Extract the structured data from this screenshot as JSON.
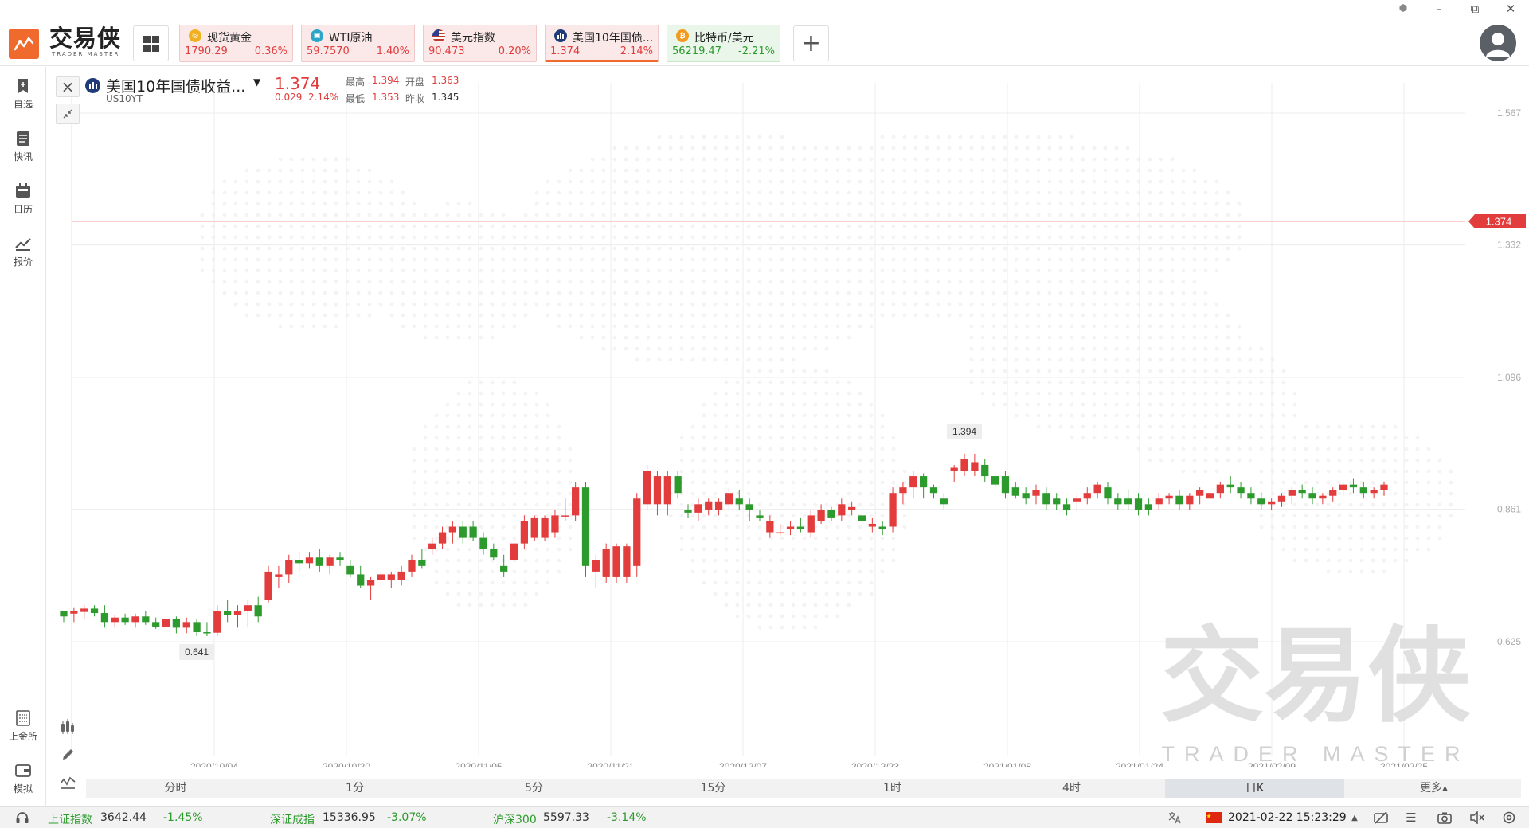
{
  "app": {
    "logo_text": "交易侠",
    "logo_sub": "TRADER MASTER"
  },
  "tickers": [
    {
      "name": "现货黄金",
      "price": "1790.29",
      "change": "0.36%",
      "trend": "up",
      "icon": "gold-icon",
      "icon_color": "#f0b020"
    },
    {
      "name": "WTI原油",
      "price": "59.7570",
      "change": "1.40%",
      "trend": "up",
      "icon": "oil-icon",
      "icon_color": "#2aa7c8"
    },
    {
      "name": "美元指数",
      "price": "90.473",
      "change": "0.20%",
      "trend": "up",
      "icon": "us-flag-icon",
      "icon_color": "#c0392b"
    },
    {
      "name": "美国10年国债...",
      "price": "1.374",
      "change": "2.14%",
      "trend": "up",
      "icon": "bond-icon",
      "icon_color": "#1f3c78",
      "active": true
    },
    {
      "name": "比特币/美元",
      "price": "56219.47",
      "change": "-2.21%",
      "trend": "down",
      "icon": "bitcoin-icon",
      "icon_color": "#f39a1e"
    }
  ],
  "sidebar": {
    "items": [
      {
        "label": "自选",
        "icon": "bookmark-icon"
      },
      {
        "label": "快讯",
        "icon": "news-icon"
      },
      {
        "label": "日历",
        "icon": "calendar-icon"
      },
      {
        "label": "报价",
        "icon": "chart-line-icon"
      }
    ],
    "bottom_items": [
      {
        "label": "上金所",
        "icon": "exchange-icon"
      },
      {
        "label": "模拟",
        "icon": "wallet-icon"
      }
    ]
  },
  "symbol": {
    "name": "美国10年国债收益...",
    "code": "US10YT",
    "price": "1.374",
    "change": "0.029",
    "change_pct": "2.14%",
    "high_label": "最高",
    "high": "1.394",
    "open_label": "开盘",
    "open": "1.363",
    "low_label": "最低",
    "low": "1.353",
    "prev_label": "昨收",
    "prev": "1.345"
  },
  "periods": [
    "分时",
    "1分",
    "5分",
    "15分",
    "1时",
    "4时",
    "日K",
    "更多▴"
  ],
  "active_period": "日K",
  "status": {
    "indices": [
      {
        "name": "上证指数",
        "value": "3642.44",
        "change": "-1.45%"
      },
      {
        "name": "深证成指",
        "value": "15336.95",
        "change": "-3.07%"
      },
      {
        "name": "沪深300",
        "value": "5597.33",
        "change": "-3.14%"
      }
    ],
    "datetime": "2021-02-22 15:23:29"
  },
  "chart_data": {
    "type": "candlestick",
    "x_tick_labels": [
      "2020/10/04",
      "2020/10/20",
      "2020/11/05",
      "2020/11/21",
      "2020/12/07",
      "2020/12/23",
      "2021/01/08",
      "2021/01/24",
      "2021/02/09",
      "2021/02/25"
    ],
    "y_tick_labels": [
      "1.567",
      "1.332",
      "1.096",
      "0.861",
      "0.625"
    ],
    "ylim": [
      0.55,
      1.6
    ],
    "current_price_label": "1.374",
    "current_price": 1.374,
    "max_label": "1.394",
    "min_label": "0.641",
    "watermark": "交易侠",
    "watermark_sub": "TRADER MASTER",
    "up_color": "#e23c3c",
    "down_color": "#2d9a2d",
    "candles": [
      [
        0.68,
        0.68,
        0.66,
        0.67
      ],
      [
        0.675,
        0.685,
        0.66,
        0.68
      ],
      [
        0.678,
        0.69,
        0.665,
        0.684
      ],
      [
        0.684,
        0.69,
        0.67,
        0.676
      ],
      [
        0.676,
        0.69,
        0.65,
        0.66
      ],
      [
        0.66,
        0.672,
        0.65,
        0.668
      ],
      [
        0.668,
        0.675,
        0.655,
        0.66
      ],
      [
        0.66,
        0.675,
        0.65,
        0.67
      ],
      [
        0.67,
        0.68,
        0.655,
        0.66
      ],
      [
        0.66,
        0.668,
        0.648,
        0.652
      ],
      [
        0.652,
        0.67,
        0.645,
        0.665
      ],
      [
        0.665,
        0.67,
        0.64,
        0.65
      ],
      [
        0.65,
        0.668,
        0.64,
        0.66
      ],
      [
        0.66,
        0.665,
        0.635,
        0.642
      ],
      [
        0.642,
        0.66,
        0.635,
        0.641
      ],
      [
        0.641,
        0.69,
        0.635,
        0.68
      ],
      [
        0.68,
        0.7,
        0.66,
        0.672
      ],
      [
        0.672,
        0.69,
        0.65,
        0.68
      ],
      [
        0.68,
        0.7,
        0.65,
        0.69
      ],
      [
        0.69,
        0.705,
        0.66,
        0.67
      ],
      [
        0.7,
        0.76,
        0.695,
        0.75
      ],
      [
        0.74,
        0.76,
        0.72,
        0.745
      ],
      [
        0.745,
        0.78,
        0.73,
        0.77
      ],
      [
        0.77,
        0.785,
        0.75,
        0.765
      ],
      [
        0.765,
        0.785,
        0.755,
        0.775
      ],
      [
        0.775,
        0.79,
        0.75,
        0.76
      ],
      [
        0.76,
        0.78,
        0.745,
        0.775
      ],
      [
        0.775,
        0.785,
        0.76,
        0.77
      ],
      [
        0.76,
        0.77,
        0.74,
        0.745
      ],
      [
        0.745,
        0.76,
        0.72,
        0.725
      ],
      [
        0.725,
        0.74,
        0.7,
        0.735
      ],
      [
        0.735,
        0.75,
        0.725,
        0.745
      ],
      [
        0.735,
        0.75,
        0.72,
        0.745
      ],
      [
        0.735,
        0.76,
        0.725,
        0.75
      ],
      [
        0.75,
        0.78,
        0.74,
        0.77
      ],
      [
        0.77,
        0.79,
        0.755,
        0.76
      ],
      [
        0.79,
        0.81,
        0.78,
        0.8
      ],
      [
        0.8,
        0.83,
        0.79,
        0.82
      ],
      [
        0.82,
        0.84,
        0.8,
        0.83
      ],
      [
        0.83,
        0.84,
        0.8,
        0.81
      ],
      [
        0.83,
        0.84,
        0.805,
        0.81
      ],
      [
        0.81,
        0.82,
        0.78,
        0.79
      ],
      [
        0.79,
        0.8,
        0.77,
        0.775
      ],
      [
        0.76,
        0.78,
        0.74,
        0.75
      ],
      [
        0.77,
        0.81,
        0.765,
        0.8
      ],
      [
        0.8,
        0.85,
        0.79,
        0.84
      ],
      [
        0.81,
        0.85,
        0.805,
        0.845
      ],
      [
        0.81,
        0.85,
        0.805,
        0.845
      ],
      [
        0.82,
        0.86,
        0.81,
        0.85
      ],
      [
        0.85,
        0.88,
        0.84,
        0.85
      ],
      [
        0.85,
        0.91,
        0.84,
        0.9
      ],
      [
        0.9,
        0.91,
        0.74,
        0.76
      ],
      [
        0.75,
        0.78,
        0.72,
        0.77
      ],
      [
        0.74,
        0.8,
        0.73,
        0.79
      ],
      [
        0.74,
        0.8,
        0.73,
        0.795
      ],
      [
        0.74,
        0.8,
        0.73,
        0.795
      ],
      [
        0.76,
        0.89,
        0.74,
        0.88
      ],
      [
        0.87,
        0.94,
        0.86,
        0.93
      ],
      [
        0.87,
        0.93,
        0.85,
        0.92
      ],
      [
        0.87,
        0.93,
        0.85,
        0.92
      ],
      [
        0.92,
        0.93,
        0.88,
        0.89
      ],
      [
        0.86,
        0.87,
        0.845,
        0.855
      ],
      [
        0.855,
        0.88,
        0.84,
        0.87
      ],
      [
        0.86,
        0.88,
        0.85,
        0.875
      ],
      [
        0.86,
        0.88,
        0.85,
        0.875
      ],
      [
        0.87,
        0.9,
        0.86,
        0.89
      ],
      [
        0.88,
        0.895,
        0.86,
        0.87
      ],
      [
        0.87,
        0.88,
        0.84,
        0.86
      ],
      [
        0.85,
        0.86,
        0.84,
        0.845
      ],
      [
        0.82,
        0.85,
        0.81,
        0.84
      ],
      [
        0.82,
        0.835,
        0.815,
        0.82
      ],
      [
        0.825,
        0.84,
        0.815,
        0.83
      ],
      [
        0.83,
        0.845,
        0.82,
        0.825
      ],
      [
        0.82,
        0.86,
        0.81,
        0.85
      ],
      [
        0.84,
        0.87,
        0.835,
        0.86
      ],
      [
        0.86,
        0.865,
        0.84,
        0.845
      ],
      [
        0.85,
        0.88,
        0.84,
        0.87
      ],
      [
        0.86,
        0.875,
        0.85,
        0.865
      ],
      [
        0.85,
        0.86,
        0.83,
        0.84
      ],
      [
        0.83,
        0.845,
        0.82,
        0.835
      ],
      [
        0.83,
        0.84,
        0.815,
        0.825
      ],
      [
        0.83,
        0.9,
        0.82,
        0.89
      ],
      [
        0.89,
        0.91,
        0.87,
        0.9
      ],
      [
        0.9,
        0.93,
        0.88,
        0.92
      ],
      [
        0.92,
        0.925,
        0.88,
        0.9
      ],
      [
        0.9,
        0.905,
        0.88,
        0.89
      ],
      [
        0.88,
        0.89,
        0.86,
        0.87
      ],
      [
        0.93,
        0.94,
        0.91,
        0.935
      ],
      [
        0.93,
        0.96,
        0.92,
        0.95
      ],
      [
        0.93,
        0.96,
        0.92,
        0.945
      ],
      [
        0.94,
        0.95,
        0.91,
        0.92
      ],
      [
        0.92,
        0.925,
        0.9,
        0.905
      ],
      [
        0.92,
        0.93,
        0.88,
        0.89
      ],
      [
        0.9,
        0.91,
        0.88,
        0.885
      ],
      [
        0.89,
        0.9,
        0.87,
        0.88
      ],
      [
        0.885,
        0.905,
        0.87,
        0.895
      ],
      [
        0.89,
        0.9,
        0.86,
        0.87
      ],
      [
        0.88,
        0.89,
        0.86,
        0.87
      ],
      [
        0.87,
        0.88,
        0.85,
        0.86
      ],
      [
        0.875,
        0.89,
        0.86,
        0.88
      ],
      [
        0.88,
        0.9,
        0.87,
        0.89
      ],
      [
        0.89,
        0.91,
        0.88,
        0.905
      ],
      [
        0.9,
        0.91,
        0.87,
        0.88
      ],
      [
        0.88,
        0.89,
        0.86,
        0.87
      ],
      [
        0.88,
        0.895,
        0.86,
        0.87
      ],
      [
        0.88,
        0.89,
        0.85,
        0.86
      ],
      [
        0.87,
        0.88,
        0.85,
        0.86
      ],
      [
        0.87,
        0.89,
        0.86,
        0.88
      ],
      [
        0.88,
        0.89,
        0.87,
        0.885
      ],
      [
        0.885,
        0.895,
        0.86,
        0.87
      ],
      [
        0.87,
        0.89,
        0.86,
        0.885
      ],
      [
        0.885,
        0.9,
        0.87,
        0.895
      ],
      [
        0.88,
        0.9,
        0.87,
        0.89
      ],
      [
        0.89,
        0.91,
        0.88,
        0.905
      ],
      [
        0.905,
        0.92,
        0.89,
        0.9
      ],
      [
        0.9,
        0.91,
        0.88,
        0.89
      ],
      [
        0.89,
        0.9,
        0.87,
        0.88
      ],
      [
        0.88,
        0.89,
        0.86,
        0.87
      ],
      [
        0.87,
        0.88,
        0.86,
        0.875
      ],
      [
        0.875,
        0.89,
        0.865,
        0.885
      ],
      [
        0.885,
        0.9,
        0.87,
        0.895
      ],
      [
        0.895,
        0.905,
        0.88,
        0.89
      ],
      [
        0.89,
        0.9,
        0.87,
        0.88
      ],
      [
        0.88,
        0.89,
        0.87,
        0.885
      ],
      [
        0.885,
        0.9,
        0.875,
        0.895
      ],
      [
        0.895,
        0.91,
        0.885,
        0.905
      ],
      [
        0.905,
        0.915,
        0.89,
        0.9
      ],
      [
        0.9,
        0.91,
        0.88,
        0.89
      ],
      [
        0.89,
        0.9,
        0.88,
        0.895
      ],
      [
        0.895,
        0.91,
        0.885,
        0.905
      ]
    ]
  }
}
